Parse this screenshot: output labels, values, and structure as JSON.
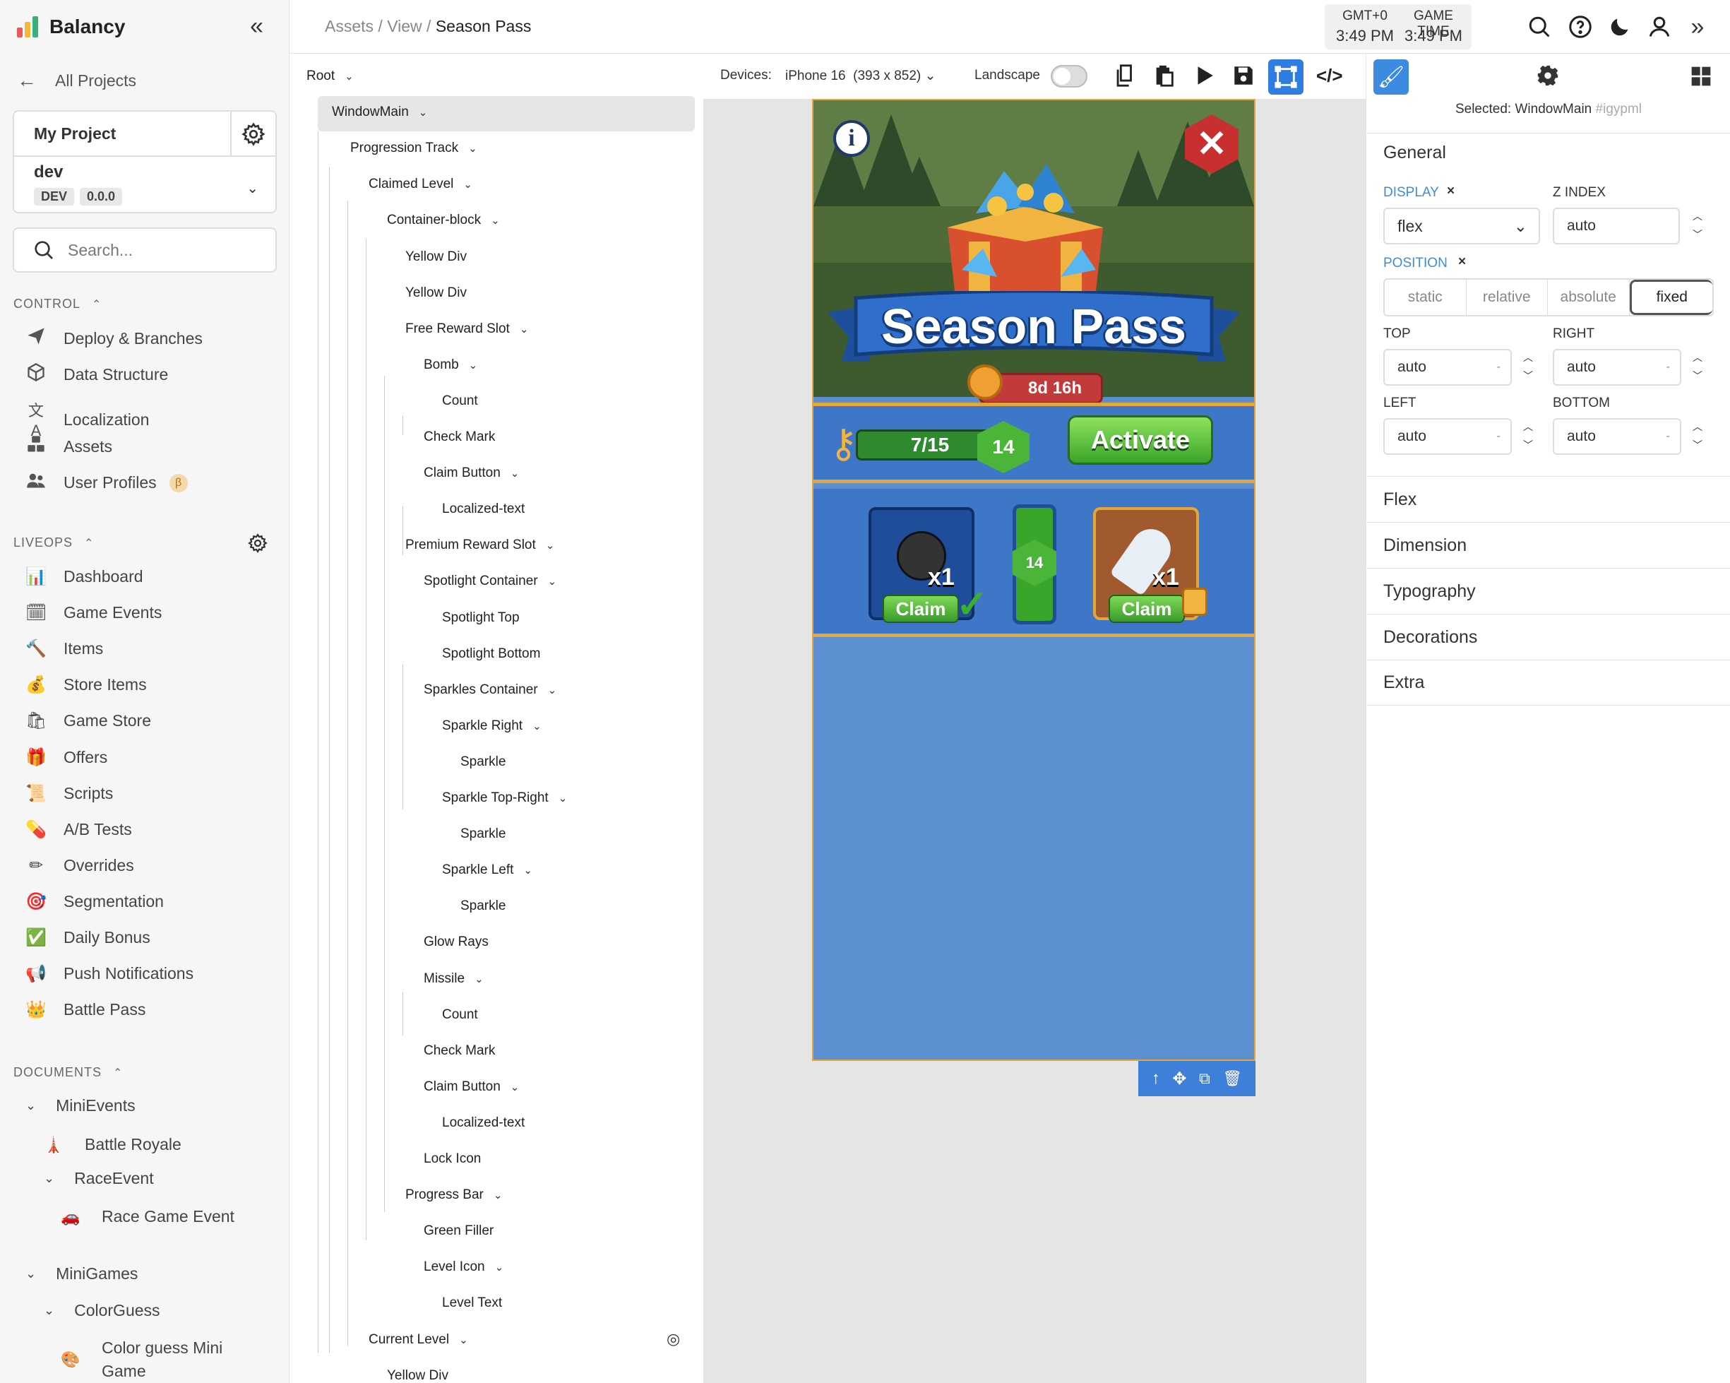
{
  "app": {
    "name": "Balancy"
  },
  "sidebar": {
    "all_projects": "All Projects",
    "project": {
      "name": "My Project",
      "env": "dev",
      "env_badge": "DEV",
      "version": "0.0.0"
    },
    "search_placeholder": "Search...",
    "control_title": "CONTROL",
    "control_items": [
      {
        "label": "Deploy & Branches",
        "icon": "paper-plane-icon"
      },
      {
        "label": "Data Structure",
        "icon": "cube-icon"
      },
      {
        "label": "Localization",
        "icon": "translate-icon"
      },
      {
        "label": "Assets",
        "icon": "boxes-icon"
      },
      {
        "label": "User Profiles",
        "icon": "users-icon",
        "badge": "β"
      }
    ],
    "liveops_title": "LIVEOPS",
    "liveops_items": [
      {
        "label": "Dashboard",
        "icon": "📊"
      },
      {
        "label": "Game Events",
        "icon": "🗓"
      },
      {
        "label": "Items",
        "icon": "🔨"
      },
      {
        "label": "Store Items",
        "icon": "💰"
      },
      {
        "label": "Game Store",
        "icon": "🛍"
      },
      {
        "label": "Offers",
        "icon": "🎁"
      },
      {
        "label": "Scripts",
        "icon": "📜"
      },
      {
        "label": "A/B Tests",
        "icon": "💊"
      },
      {
        "label": "Overrides",
        "icon": "✏"
      },
      {
        "label": "Segmentation",
        "icon": "🎯"
      },
      {
        "label": "Daily Bonus",
        "icon": "✅"
      },
      {
        "label": "Push Notifications",
        "icon": "📢"
      },
      {
        "label": "Battle Pass",
        "icon": "👑"
      }
    ],
    "documents_title": "DOCUMENTS",
    "documents": [
      {
        "label": "MiniEvents",
        "type": "folder"
      },
      {
        "label": "Battle Royale",
        "type": "doc",
        "icon": "🗼"
      },
      {
        "label": "RaceEvent",
        "type": "folder"
      },
      {
        "label": "Race Game Event",
        "type": "doc",
        "icon": "🚗"
      },
      {
        "label": "MiniGames",
        "type": "folder"
      },
      {
        "label": "ColorGuess",
        "type": "folder"
      },
      {
        "label": "Color guess Mini Game",
        "type": "doc",
        "icon": "🎨"
      }
    ]
  },
  "topbar": {
    "breadcrumb": [
      "Assets",
      "View",
      "Season Pass"
    ],
    "tz_label": "GMT+0",
    "tz_time": "3:49 PM",
    "game_label": "GAME TIME",
    "game_time": "3:49 PM"
  },
  "toolbar": {
    "devices_label": "Devices:",
    "device": "iPhone 16",
    "device_res": "(393 x 852)",
    "landscape_label": "Landscape"
  },
  "tree": [
    {
      "label": "Root",
      "depth": 0,
      "chevron": true
    },
    {
      "label": "WindowMain",
      "depth": 1,
      "chevron": true,
      "selected": true
    },
    {
      "label": "Progression Track",
      "depth": 2,
      "chevron": true
    },
    {
      "label": "Claimed Level",
      "depth": 3,
      "chevron": true
    },
    {
      "label": "Container-block",
      "depth": 4,
      "chevron": true
    },
    {
      "label": "Yellow Div",
      "depth": 5
    },
    {
      "label": "Yellow Div",
      "depth": 5
    },
    {
      "label": "Free Reward Slot",
      "depth": 5,
      "chevron": true
    },
    {
      "label": "Bomb",
      "depth": 6,
      "chevron": true
    },
    {
      "label": "Count",
      "depth": 7
    },
    {
      "label": "Check Mark",
      "depth": 6
    },
    {
      "label": "Claim Button",
      "depth": 6,
      "chevron": true
    },
    {
      "label": "Localized-text",
      "depth": 7
    },
    {
      "label": "Premium Reward Slot",
      "depth": 5,
      "chevron": true
    },
    {
      "label": "Spotlight Container",
      "depth": 6,
      "chevron": true
    },
    {
      "label": "Spotlight Top",
      "depth": 7
    },
    {
      "label": "Spotlight Bottom",
      "depth": 7
    },
    {
      "label": "Sparkles Container",
      "depth": 6,
      "chevron": true
    },
    {
      "label": "Sparkle Right",
      "depth": 7,
      "chevron": true
    },
    {
      "label": "Sparkle",
      "depth": 8
    },
    {
      "label": "Sparkle Top-Right",
      "depth": 7,
      "chevron": true
    },
    {
      "label": "Sparkle",
      "depth": 8
    },
    {
      "label": "Sparkle Left",
      "depth": 7,
      "chevron": true
    },
    {
      "label": "Sparkle",
      "depth": 8
    },
    {
      "label": "Glow Rays",
      "depth": 6
    },
    {
      "label": "Missile",
      "depth": 6,
      "chevron": true
    },
    {
      "label": "Count",
      "depth": 7
    },
    {
      "label": "Check Mark",
      "depth": 6
    },
    {
      "label": "Claim Button",
      "depth": 6,
      "chevron": true
    },
    {
      "label": "Localized-text",
      "depth": 7
    },
    {
      "label": "Lock Icon",
      "depth": 6
    },
    {
      "label": "Progress Bar",
      "depth": 5,
      "chevron": true
    },
    {
      "label": "Green Filler",
      "depth": 6
    },
    {
      "label": "Level Icon",
      "depth": 6,
      "chevron": true
    },
    {
      "label": "Level Text",
      "depth": 7
    },
    {
      "label": "Current Level",
      "depth": 3,
      "chevron": true,
      "hidden_icon": true
    },
    {
      "label": "Yellow Div",
      "depth": 4
    }
  ],
  "game": {
    "title": "Season Pass",
    "timer": "8d 16h",
    "progress": "7/15",
    "level": "14",
    "activate": "Activate",
    "track_level": "14",
    "free_count": "x1",
    "premium_count": "x1",
    "claim": "Claim"
  },
  "panel": {
    "selected_label": "Selected:",
    "selected_name": "WindowMain",
    "selected_id": "#igypml",
    "general": "General",
    "display_label": "DISPLAY",
    "display_value": "flex",
    "zindex_label": "Z INDEX",
    "zindex_value": "auto",
    "position_label": "POSITION",
    "position_options": [
      "static",
      "relative",
      "absolute",
      "fixed"
    ],
    "position_selected": "fixed",
    "top_label": "TOP",
    "top_value": "auto",
    "right_label": "RIGHT",
    "right_value": "auto",
    "left_label": "LEFT",
    "left_value": "auto",
    "bottom_label": "BOTTOM",
    "bottom_value": "auto",
    "unit_placeholder": "-",
    "sections": [
      "Flex",
      "Dimension",
      "Typography",
      "Decorations",
      "Extra"
    ]
  },
  "colors": {
    "accent": "#4a90e2",
    "game_bg": "#5b8fcf",
    "gold": "#e3a63a"
  }
}
